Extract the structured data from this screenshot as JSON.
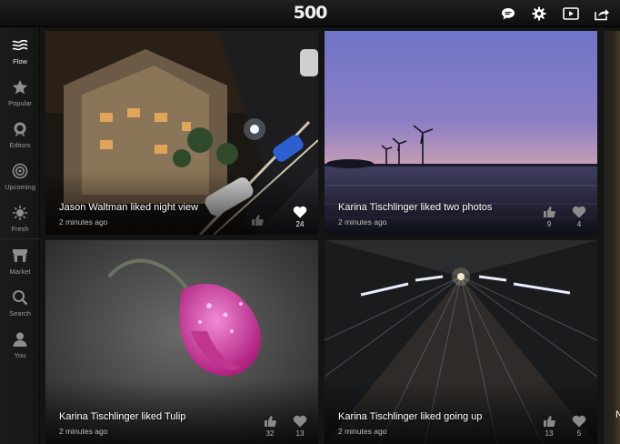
{
  "app": {
    "logo": "500"
  },
  "topbar": {
    "icons": [
      "chat-icon",
      "gear-icon",
      "slideshow-icon",
      "share-icon"
    ]
  },
  "sidebar": {
    "items": [
      {
        "label": "Flow",
        "icon": "flow-icon",
        "active": true
      },
      {
        "label": "Popular",
        "icon": "star-icon",
        "active": false
      },
      {
        "label": "Editors",
        "icon": "editors-badge-icon",
        "active": false
      },
      {
        "label": "Upcoming",
        "icon": "target-icon",
        "active": false
      },
      {
        "label": "Fresh",
        "icon": "sun-icon",
        "active": false
      },
      {
        "label": "Market",
        "icon": "market-icon",
        "active": false
      },
      {
        "label": "Search",
        "icon": "magnifier-icon",
        "active": false
      },
      {
        "label": "You",
        "icon": "person-icon",
        "active": false
      }
    ]
  },
  "feed": {
    "tiles": [
      {
        "caption": "Jason Waltman liked night view",
        "time": "2 minutes ago",
        "likes": "",
        "favorites": "24",
        "favorited": true
      },
      {
        "caption": "Karina Tischlinger liked two photos",
        "time": "2 minutes ago",
        "likes": "9",
        "favorites": "4",
        "favorited": false
      },
      {
        "caption": "Karina Tischlinger liked Tulip",
        "time": "2 minutes ago",
        "likes": "32",
        "favorites": "13",
        "favorited": false
      },
      {
        "caption": "Karina Tischlinger liked going up",
        "time": "2 minutes ago",
        "likes": "13",
        "favorites": "5",
        "favorited": false
      }
    ],
    "partial_caption": "N"
  }
}
